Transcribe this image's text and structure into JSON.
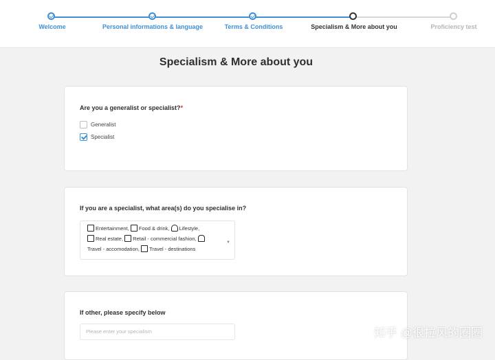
{
  "stepper": {
    "steps": [
      {
        "label": "Welcome",
        "state": "done"
      },
      {
        "label": "Personal informations & language",
        "state": "done"
      },
      {
        "label": "Terms & Conditions",
        "state": "done"
      },
      {
        "label": "Specialism & More about you",
        "state": "current"
      },
      {
        "label": "Proficiency test",
        "state": "todo"
      }
    ]
  },
  "page_title": "Specialism & More about you",
  "q1": {
    "label": "Are you a generalist or specialist?",
    "required_mark": "*",
    "options": [
      {
        "label": "Generalist",
        "checked": false
      },
      {
        "label": "Specialist",
        "checked": true
      }
    ]
  },
  "q2": {
    "label": "If you are a specialist, what area(s) do you specialise in?",
    "selected": [
      "Entertainment,",
      "Food & drink,",
      "Lifestyle,",
      "Real estate,",
      "Retail - commercial fashion,",
      "Travel - accomodation,",
      "Travel - destinations"
    ],
    "icons": [
      "ticket-icon",
      "food-icon",
      "lifestyle-icon",
      "building-icon",
      "shopping-bag-icon",
      "hotel-icon",
      "map-icon"
    ]
  },
  "q3": {
    "label": "If other, please specify below",
    "placeholder": "Please enter your specialism"
  },
  "watermark": "知乎 @很拉风的圈圈",
  "colors": {
    "accent": "#3f8fd6",
    "pending": "#d6d6d6",
    "required": "#dd3333"
  }
}
